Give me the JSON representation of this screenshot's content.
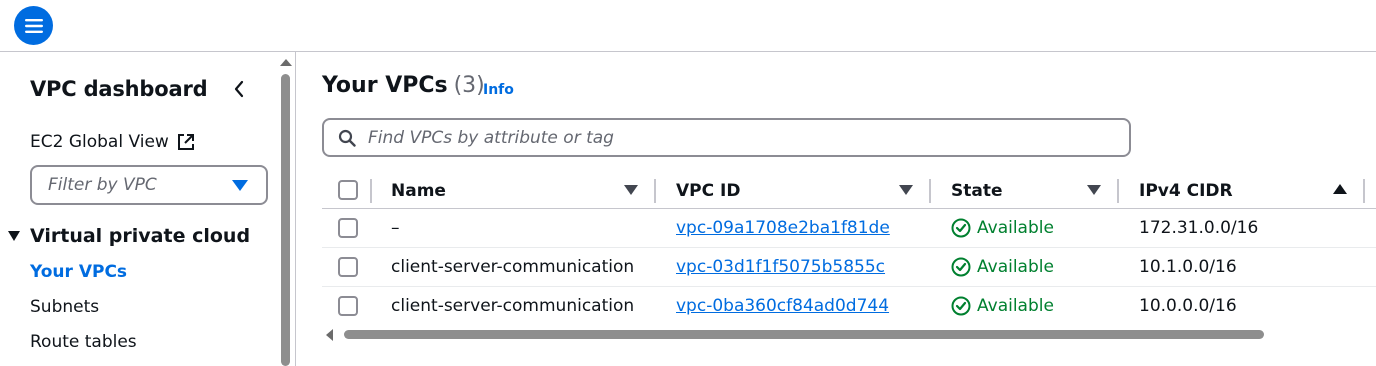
{
  "topbar": {
    "menu_icon": "hamburger-menu-icon",
    "accent": "#006ce0"
  },
  "sidebar": {
    "title": "VPC dashboard",
    "global_view": "EC2 Global View",
    "filter_placeholder": "Filter by VPC",
    "section": "Virtual private cloud",
    "items": [
      {
        "label": "Your VPCs",
        "active": true
      },
      {
        "label": "Subnets",
        "active": false
      },
      {
        "label": "Route tables",
        "active": false
      }
    ]
  },
  "main": {
    "title": "Your VPCs",
    "count": "(3)",
    "info": "Info",
    "search_placeholder": "Find VPCs by attribute or tag"
  },
  "table": {
    "columns": [
      "Name",
      "VPC ID",
      "State",
      "IPv4 CIDR"
    ],
    "rows": [
      {
        "name": "–",
        "vpc_id": "vpc-09a1708e2ba1f81de",
        "state": "Available",
        "cidr": "172.31.0.0/16"
      },
      {
        "name": "client-server-communication",
        "vpc_id": "vpc-03d1f1f5075b5855c",
        "state": "Available",
        "cidr": "10.1.0.0/16"
      },
      {
        "name": "client-server-communication",
        "vpc_id": "vpc-0ba360cf84ad0d744",
        "state": "Available",
        "cidr": "10.0.0.0/16"
      }
    ]
  },
  "colors": {
    "link": "#006ce0",
    "success": "#00802f"
  }
}
